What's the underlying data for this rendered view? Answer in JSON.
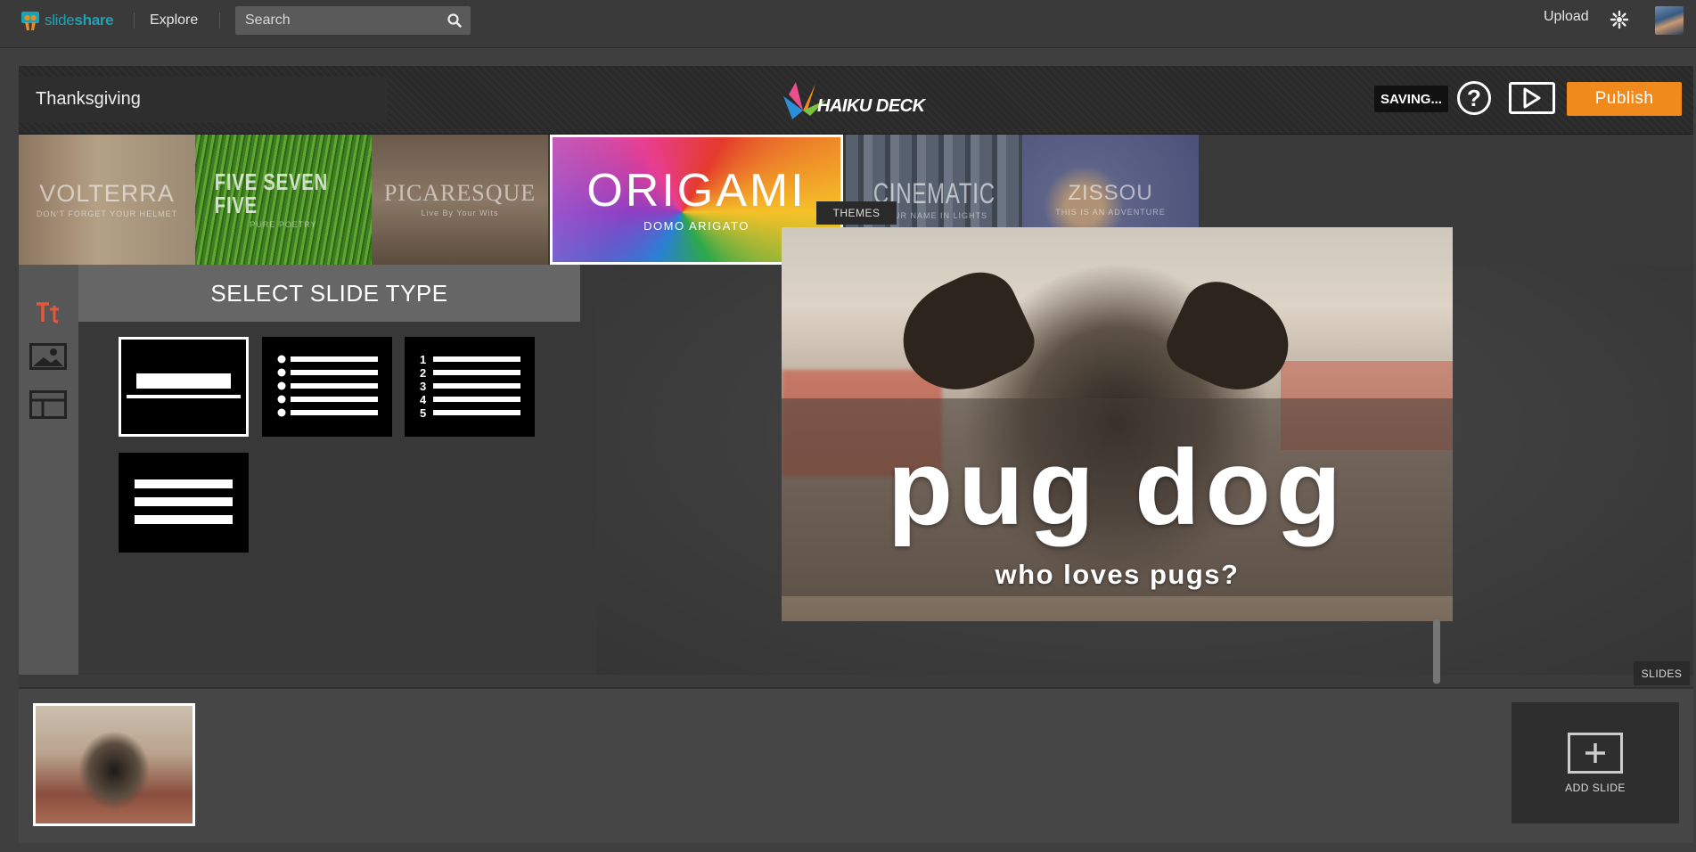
{
  "topbar": {
    "brand_a": "slide",
    "brand_b": "share",
    "explore": "Explore",
    "search_placeholder": "Search",
    "upload": "Upload"
  },
  "editor": {
    "deck_title": "Thanksgiving",
    "logo_text": "HAIKU DECK",
    "status": "SAVING...",
    "help": "?",
    "publish": "Publish"
  },
  "themes": [
    {
      "name": "VOLTERRA",
      "tagline": "DON'T FORGET YOUR HELMET"
    },
    {
      "name": "FIVE SEVEN FIVE",
      "tagline": "PURE POETRY"
    },
    {
      "name": "PICARESQUE",
      "tagline": "Live By Your Wits"
    },
    {
      "name": "ORIGAMI",
      "tagline": "DOMO ARIGATO",
      "selected": true
    },
    {
      "name": "CINEMATIC",
      "tagline": "YOUR NAME IN LIGHTS"
    },
    {
      "name": "ZISSOU",
      "tagline": "THIS IS AN ADVENTURE"
    }
  ],
  "panel": {
    "heading": "SELECT SLIDE TYPE",
    "tools": [
      "text-tool-icon",
      "image-tool-icon",
      "layout-tool-icon"
    ],
    "slide_types": [
      "title",
      "bullets",
      "numbered",
      "paragraph"
    ],
    "selected_type": "title",
    "numbers": [
      "1",
      "2",
      "3",
      "4",
      "5"
    ]
  },
  "tabs": {
    "themes": "THEMES",
    "slides": "SLIDES"
  },
  "slide": {
    "title": "pug dog",
    "subtitle": "who loves pugs?"
  },
  "filmstrip": {
    "add_slide": "ADD SLIDE"
  },
  "colors": {
    "accent": "#f18a1c",
    "brand": "#1aa3b7",
    "tool_active": "#e8573a"
  }
}
